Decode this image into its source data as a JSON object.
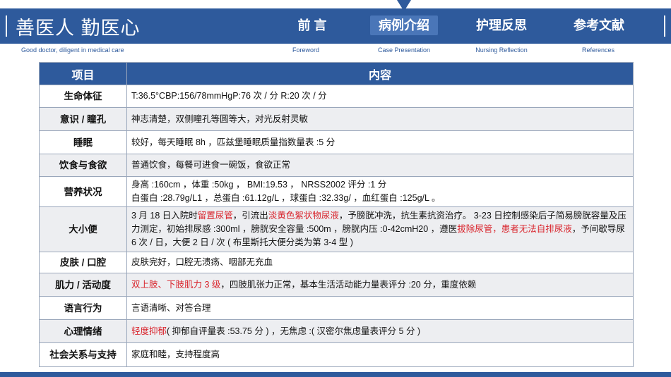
{
  "header": {
    "brand": "善医人 勤医心",
    "slogan": "Good doctor, diligent in medical care",
    "nav": [
      {
        "label": "前 言",
        "en": "Foreword"
      },
      {
        "label": "病例介绍",
        "en": "Case Presentation"
      },
      {
        "label": "护理反思",
        "en": "Nursing Reflection"
      },
      {
        "label": "参考文献",
        "en": "References"
      }
    ],
    "active_index": 1,
    "accent_color": "#2E5A9C",
    "highlight_color": "#D9232B"
  },
  "table": {
    "headers": [
      "项目",
      "内容"
    ],
    "rows": [
      {
        "item": "生命体征",
        "content": [
          {
            "t": "T:36.5°CBP:156/78mmHgP:76 次 / 分 R:20 次 / 分"
          }
        ]
      },
      {
        "item": "意识 / 瞳孔",
        "content": [
          {
            "t": "神志清楚，双侧瞳孔等圆等大，对光反射灵敏"
          }
        ]
      },
      {
        "item": "睡眠",
        "content": [
          {
            "t": "较好，每天睡眠 8h ，匹兹堡睡眠质量指数量表 :5 分"
          }
        ]
      },
      {
        "item": "饮食与食欲",
        "content": [
          {
            "t": "普通饮食，每餐可进食一碗饭，食欲正常"
          }
        ]
      },
      {
        "item": "营养状况",
        "content": [
          {
            "t": "身高 :160cm ，体重 :50kg ， BMI:19.53 ， NRSS2002 评分 :1 分"
          },
          {
            "br": true
          },
          {
            "t": "白蛋白 :28.79g/L1 ，总蛋白 :61.12g/L ，球蛋白 :32.33g/ ，血红蛋白 :125g/L 。"
          }
        ]
      },
      {
        "item": "大小便",
        "content": [
          {
            "t": "3 月 18 日入院时"
          },
          {
            "t": "留置尿管",
            "red": true
          },
          {
            "t": "，引流出"
          },
          {
            "t": "淡黄色絮状物尿液",
            "red": true
          },
          {
            "t": "，予膀胱冲洗，抗生素抗资治疗。 3-23 日控制感染后子简易膀胱容量及压力测定，初始排尿感 :300ml ，膀胱安全容量 :500m ，膀胱内压 :0-42cmH20 ，遵医"
          },
          {
            "t": "拔除尿管，患者无法自排尿液",
            "red": true
          },
          {
            "t": "，予间歇导尿 6 次 / 日，大便 2 日 / 次 ( 布里斯托大便分类为第 3-4 型 )"
          }
        ]
      },
      {
        "item": "皮肤 / 口腔",
        "content": [
          {
            "t": "皮肤完好，口腔无溃疡、咽部无充血"
          }
        ]
      },
      {
        "item": "肌力 / 活动度",
        "content": [
          {
            "t": "双上肢、下肢肌力 3 级",
            "red": true
          },
          {
            "t": "，四肢肌张力正常，基本生活活动能力量表评分 :20 分，重度依赖"
          }
        ]
      },
      {
        "item": "语言行为",
        "content": [
          {
            "t": "言语清晰、对答合理"
          }
        ]
      },
      {
        "item": "心理情绪",
        "content": [
          {
            "t": "轻度抑郁",
            "red": true
          },
          {
            "t": "( 抑郁自评量表 :53.75 分 ) ，无焦虑 :( 汉密尔焦虑量表评分 5 分 )"
          }
        ]
      },
      {
        "item": "社会关系与支持",
        "content": [
          {
            "t": "家庭和睦，支持程度高"
          }
        ]
      }
    ]
  }
}
